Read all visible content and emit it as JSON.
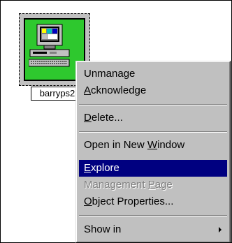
{
  "node": {
    "label": "barryps2",
    "icon": "workstation-computer-icon",
    "status_color": "#2ec82e"
  },
  "menu": {
    "items": [
      {
        "label": "Unmanage",
        "mnemonic": "",
        "rest": "Unmanage"
      },
      {
        "label": "Acknowledge",
        "mnemonic": "A",
        "rest": "cknowledge"
      },
      {
        "label": "Delete...",
        "mnemonic": "D",
        "rest": "elete..."
      },
      {
        "label": "Open in New Window",
        "pre": "Open in New ",
        "mnemonic": "W",
        "rest": "indow"
      },
      {
        "label": "Explore",
        "mnemonic": "E",
        "rest": "xplore",
        "selected": true
      },
      {
        "label": "Management Page",
        "pre": "Management ",
        "mnemonic": "P",
        "rest": "age",
        "disabled": true
      },
      {
        "label": "Object Properties...",
        "mnemonic": "O",
        "rest": "bject Properties..."
      },
      {
        "label": "Show in",
        "submenu": true
      }
    ]
  },
  "colors": {
    "highlight": "#000080",
    "menu_bg": "#c0c0c0"
  }
}
